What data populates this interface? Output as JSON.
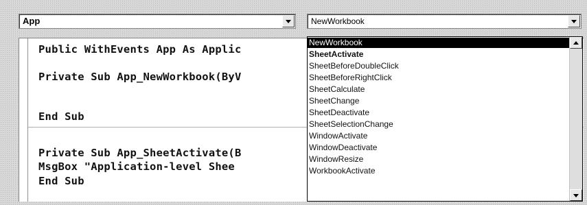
{
  "object_combo": {
    "value": "App"
  },
  "procedure_combo": {
    "value": "NewWorkbook"
  },
  "code": {
    "lines": [
      "Public WithEvents App As Applic",
      "Private Sub App_NewWorkbook(ByV",
      "End Sub",
      "Private Sub App_SheetActivate(B",
      "MsgBox \"Application-level Shee",
      "End Sub"
    ]
  },
  "procedure_list": {
    "items": [
      "NewWorkbook",
      "SheetActivate",
      "SheetBeforeDoubleClick",
      "SheetBeforeRightClick",
      "SheetCalculate",
      "SheetChange",
      "SheetDeactivate",
      "SheetSelectionChange",
      "WindowActivate",
      "WindowDeactivate",
      "WindowResize",
      "WorkbookActivate"
    ],
    "selected_index": 0,
    "bold_index": 1
  },
  "icons": {
    "dropdown": "chevron-down-icon",
    "scroll_up": "arrow-up-icon",
    "scroll_down": "arrow-down-icon"
  },
  "colors": {
    "selection_bg": "#000000",
    "selection_fg": "#ffffff",
    "chrome": "#d8d8d8"
  }
}
